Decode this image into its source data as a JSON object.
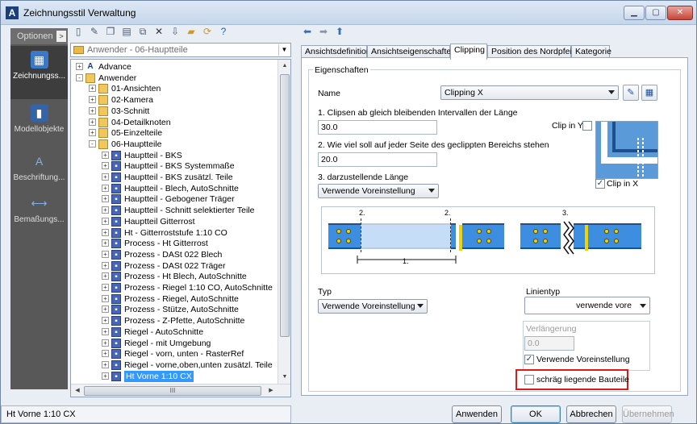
{
  "window": {
    "title": "Zeichnungsstil Verwaltung",
    "buttons": [
      "minimize",
      "maximize",
      "close"
    ]
  },
  "left_nav": {
    "options_label": "Optionen",
    "options_arrow": ">",
    "items": [
      {
        "label": "Zeichnungss...",
        "icon": "drawing-style-icon",
        "selected": true
      },
      {
        "label": "Modellobjekte",
        "icon": "model-objects-icon",
        "selected": false
      },
      {
        "label": "Beschriftung...",
        "icon": "annotation-icon",
        "selected": false
      },
      {
        "label": "Bemaßungs...",
        "icon": "dimension-icon",
        "selected": false
      }
    ]
  },
  "toolbar_left": {
    "icons": [
      "new-style-icon",
      "edit-icon",
      "copy-icon",
      "paste-icon",
      "duplicate-icon",
      "delete-icon",
      "import-icon",
      "export-icon",
      "refresh-icon",
      "help-icon"
    ]
  },
  "path_combo": {
    "value": "Anwender - 06-Hauptteile"
  },
  "tree": {
    "nodes": [
      {
        "label": "Advance",
        "depth": 0,
        "icon": "advance-logo",
        "exp": "+"
      },
      {
        "label": "Anwender",
        "depth": 0,
        "icon": "folder-icon",
        "exp": "-"
      },
      {
        "label": "01-Ansichten",
        "depth": 1,
        "icon": "folder-icon",
        "exp": "+"
      },
      {
        "label": "02-Kamera",
        "depth": 1,
        "icon": "folder-icon",
        "exp": "+"
      },
      {
        "label": "03-Schnitt",
        "depth": 1,
        "icon": "folder-icon",
        "exp": "+"
      },
      {
        "label": "04-Detailknoten",
        "depth": 1,
        "icon": "folder-icon",
        "exp": "+"
      },
      {
        "label": "05-Einzelteile",
        "depth": 1,
        "icon": "folder-icon",
        "exp": "+"
      },
      {
        "label": "06-Hauptteile",
        "depth": 1,
        "icon": "folder-icon",
        "exp": "-"
      },
      {
        "label": "Hauptteil - BKS",
        "depth": 2,
        "icon": "style-icon",
        "exp": "+"
      },
      {
        "label": "Hauptteil - BKS Systemmaße",
        "depth": 2,
        "icon": "style-icon",
        "exp": "+"
      },
      {
        "label": "Hauptteil - BKS zusätzl. Teile",
        "depth": 2,
        "icon": "style-icon",
        "exp": "+"
      },
      {
        "label": "Hauptteil - Blech, AutoSchnitte",
        "depth": 2,
        "icon": "style-icon",
        "exp": "+"
      },
      {
        "label": "Hauptteil - Gebogener Träger",
        "depth": 2,
        "icon": "style-icon",
        "exp": "+"
      },
      {
        "label": "Hauptteil - Schnitt selektierter Teile",
        "depth": 2,
        "icon": "style-icon",
        "exp": "+"
      },
      {
        "label": "Hauptteil Gitterrost",
        "depth": 2,
        "icon": "style-icon",
        "exp": "+"
      },
      {
        "label": "Ht - Gitterroststufe 1:10 CO",
        "depth": 2,
        "icon": "style-icon",
        "exp": "+"
      },
      {
        "label": "Process - Ht Gitterrost",
        "depth": 2,
        "icon": "style-icon",
        "exp": "+"
      },
      {
        "label": "Prozess - DASt 022 Blech",
        "depth": 2,
        "icon": "style-icon",
        "exp": "+"
      },
      {
        "label": "Prozess - DASt 022 Träger",
        "depth": 2,
        "icon": "style-icon",
        "exp": "+"
      },
      {
        "label": "Prozess - Ht Blech, AutoSchnitte",
        "depth": 2,
        "icon": "style-icon",
        "exp": "+"
      },
      {
        "label": "Prozess - Riegel 1:10 CO, AutoSchnitte",
        "depth": 2,
        "icon": "style-icon",
        "exp": "+"
      },
      {
        "label": "Prozess - Riegel, AutoSchnitte",
        "depth": 2,
        "icon": "style-icon",
        "exp": "+"
      },
      {
        "label": "Prozess - Stütze, AutoSchnitte",
        "depth": 2,
        "icon": "style-icon",
        "exp": "+"
      },
      {
        "label": "Prozess - Z-Pfette, AutoSchnitte",
        "depth": 2,
        "icon": "style-icon",
        "exp": "+"
      },
      {
        "label": "Riegel - AutoSchnitte",
        "depth": 2,
        "icon": "style-icon",
        "exp": "+"
      },
      {
        "label": "Riegel - mit Umgebung",
        "depth": 2,
        "icon": "style-icon",
        "exp": "+"
      },
      {
        "label": "Riegel - vorn, unten - RasterRef",
        "depth": 2,
        "icon": "style-icon",
        "exp": "+"
      },
      {
        "label": "Riegel - vorne,oben,unten zusätzl. Teile",
        "depth": 2,
        "icon": "style-icon",
        "exp": "+"
      },
      {
        "label": "Ht Vorne 1:10 CX",
        "depth": 2,
        "icon": "style-icon",
        "exp": "+",
        "selected": true
      }
    ],
    "hscroll_grip": "III"
  },
  "toolbar_right": {
    "icons": [
      "back-arrow-icon",
      "forward-arrow-icon",
      "up-arrow-icon"
    ]
  },
  "tabs": [
    {
      "label": "Ansichtsdefinition",
      "active": false
    },
    {
      "label": "Ansichtseigenschaften",
      "active": false
    },
    {
      "label": "Clipping",
      "active": true
    },
    {
      "label": "Position des Nordpfeils",
      "active": false
    },
    {
      "label": "Kategorie",
      "active": false
    }
  ],
  "clipping": {
    "group_title": "Eigenschaften",
    "name_label": "Name",
    "name_value": "Clipping X",
    "q1_label": "1. Clipsen ab gleich bleibenden Intervallen der Länge",
    "q1_value": "30.0",
    "clip_y_label": "Clip in Y",
    "clip_y_checked": false,
    "q2_label": "2. Wie viel soll auf jeder Seite des geclippten Bereichs stehen",
    "q2_value": "20.0",
    "q3_label": "3. darzustellende Länge",
    "q3_value": "Verwende Voreinstellung",
    "clip_x_label": "Clip in X",
    "clip_x_checked": true,
    "diagram_labels": {
      "d2a": "2.",
      "d2b": "2.",
      "d3": "3.",
      "d1": "1."
    },
    "typ_label": "Typ",
    "typ_value": "Verwende Voreinstellung",
    "linientyp_label": "Linientyp",
    "linientyp_value": "verwende vore",
    "verl_label": "Verlängerung",
    "verl_value": "0.0",
    "verl_default_label": "Verwende Voreinstellung",
    "verl_default_checked": true,
    "schraeg_label": "schräg liegende Bauteile",
    "schraeg_checked": false,
    "highlight_color": "#e01818"
  },
  "footer": {
    "status": "Ht Vorne 1:10 CX",
    "apply": "Anwenden",
    "ok": "OK",
    "cancel": "Abbrechen",
    "take_over": "Übernehmen"
  }
}
